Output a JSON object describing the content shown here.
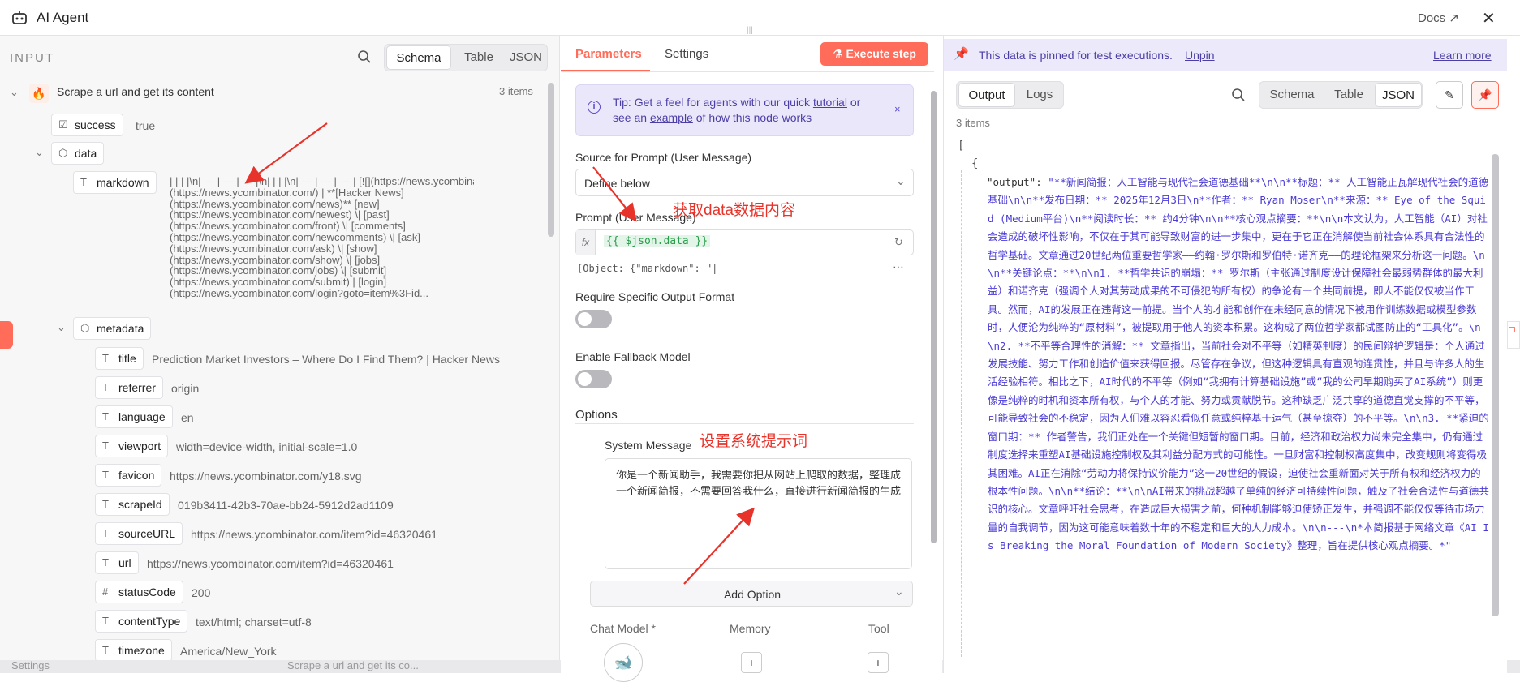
{
  "window": {
    "title": "AI Agent",
    "docs_label": "Docs",
    "close": "✕"
  },
  "input": {
    "heading": "INPUT",
    "view_tabs": [
      "Schema",
      "Table",
      "JSON"
    ],
    "active_view": "Schema",
    "node_name": "Scrape a url and get its content",
    "items_count": "3 items",
    "fields": {
      "success": {
        "key": "success",
        "value": "true"
      },
      "data": {
        "key": "data"
      },
      "markdown": {
        "key": "markdown",
        "value": "| | | |\\n| --- | --- | --- |\\n| | | |\\n| --- | --- | --- | [![](https://news.ycombinator.com/y18.svg)]\n(https://news.ycombinator.com/) | **[Hacker News]\n(https://news.ycombinator.com/news)** [new]\n(https://news.ycombinator.com/newest) \\| [past]\n(https://news.ycombinator.com/front) \\| [comments]\n(https://news.ycombinator.com/newcomments) \\| [ask]\n(https://news.ycombinator.com/ask) \\| [show]\n(https://news.ycombinator.com/show) \\| [jobs]\n(https://news.ycombinator.com/jobs) \\| [submit]\n(https://news.ycombinator.com/submit) | [login]\n(https://news.ycombinator.com/login?goto=item%3Fid..."
      },
      "metadata": {
        "key": "metadata"
      },
      "meta_rows": [
        {
          "key": "title",
          "value": "Prediction Market Investors – Where Do I Find Them? | Hacker News",
          "type": "T"
        },
        {
          "key": "referrer",
          "value": "origin",
          "type": "T"
        },
        {
          "key": "language",
          "value": "en",
          "type": "T"
        },
        {
          "key": "viewport",
          "value": "width=device-width, initial-scale=1.0",
          "type": "T"
        },
        {
          "key": "favicon",
          "value": "https://news.ycombinator.com/y18.svg",
          "type": "T"
        },
        {
          "key": "scrapeId",
          "value": "019b3411-42b3-70ae-bb24-5912d2ad1109",
          "type": "T"
        },
        {
          "key": "sourceURL",
          "value": "https://news.ycombinator.com/item?id=46320461",
          "type": "T"
        },
        {
          "key": "url",
          "value": "https://news.ycombinator.com/item?id=46320461",
          "type": "T"
        },
        {
          "key": "statusCode",
          "value": "200",
          "type": "#"
        },
        {
          "key": "contentType",
          "value": "text/html; charset=utf-8",
          "type": "T"
        },
        {
          "key": "timezone",
          "value": "America/New_York",
          "type": "T"
        }
      ]
    },
    "bottom_hint": "Settings",
    "bottom_hint2": "Scrape a url and get its co..."
  },
  "parameters": {
    "tabs": [
      "Parameters",
      "Settings"
    ],
    "execute_label": "Execute step",
    "tip_text_1": "Tip: Get a feel for agents with our quick ",
    "tip_link_1": "tutorial",
    "tip_text_2": " or",
    "tip_text_3": "see an ",
    "tip_link_2": "example",
    "tip_text_4": " of how this node works",
    "source_label": "Source for Prompt (User Message)",
    "source_value": "Define below",
    "prompt_label": "Prompt (User Message)",
    "prompt_value": "{{ $json.data }}",
    "prompt_preview": "[Object: {\"markdown\": \"|",
    "require_format_label": "Require Specific Output Format",
    "fallback_label": "Enable Fallback Model",
    "options_label": "Options",
    "system_message_label": "System Message",
    "system_message_value": "你是一个新闻助手，我需要你把从网站上爬取的数据，整理成一个新闻简报，不需要回答我什么，直接进行新闻简报的生成",
    "add_option_label": "Add Option",
    "sub_nodes": [
      "Chat Model *",
      "Memory",
      "Tool"
    ]
  },
  "annotations": {
    "get_data": "获取data数据内容",
    "set_prompt": "设置系统提示词"
  },
  "output": {
    "pinned_text": "This data is pinned for test executions.",
    "unpin_label": "Unpin",
    "learn_more_label": "Learn more",
    "tabs": [
      "Output",
      "Logs"
    ],
    "view_tabs": [
      "Schema",
      "Table",
      "JSON"
    ],
    "active_view": "JSON",
    "items_count": "3 items",
    "json_open": "[",
    "json_obj_open": "{",
    "json_key": "\"output\":",
    "json_value": "\"**新闻简报：人工智能与现代社会道德基础**\\n\\n**标题：** 人工智能正瓦解现代社会的道德基础\\n\\n**发布日期：** 2025年12月3日\\n**作者：** Ryan Moser\\n**来源：** Eye of the Squid (Medium平台)\\n**阅读时长：** 约4分钟\\n\\n**核心观点摘要：**\\n\\n本文认为，人工智能（AI）对社会造成的破坏性影响，不仅在于其可能导致财富的进一步集中，更在于它正在消解使当前社会体系具有合法性的哲学基础。文章通过20世纪两位重要哲学家——约翰·罗尔斯和罗伯特·诺齐克——的理论框架来分析这一问题。\\n\\n**关键论点：**\\n\\n1.  **哲学共识的崩塌：** 罗尔斯（主张通过制度设计保障社会最弱势群体的最大利益）和诺齐克（强调个人对其劳动成果的不可侵犯的所有权）的争论有一个共同前提，即人不能仅仅被当作工具。然而，AI的发展正在违背这一前提。当个人的才能和创作在未经同意的情况下被用作训练数据或模型参数时，人便沦为纯粹的“原材料”，被提取用于他人的资本积累。这构成了两位哲学家都试图防止的“工具化”。\\n\\n2.  **不平等合理性的消解：** 文章指出，当前社会对不平等（如精英制度）的民间辩护逻辑是：个人通过发展技能、努力工作和创造价值来获得回报。尽管存在争议，但这种逻辑具有直观的连贯性，并且与许多人的生活经验相符。相比之下，AI时代的不平等（例如“我拥有计算基础设施”或“我的公司早期购买了AI系统”）则更像是纯粹的时机和资本所有权，与个人的才能、努力或贡献脱节。这种缺乏广泛共享的道德直觉支撑的不平等，可能导致社会的不稳定，因为人们难以容忍看似任意或纯粹基于运气（甚至掠夺）的不平等。\\n\\n3.  **紧迫的窗口期：** 作者警告，我们正处在一个关键但短暂的窗口期。目前，经济和政治权力尚未完全集中，仍有通过制度选择来重塑AI基础设施控制权及其利益分配方式的可能性。一旦财富和控制权高度集中，改变规则将变得极其困难。AI正在消除“劳动力将保持议价能力”这一20世纪的假设，迫使社会重新面对关于所有权和经济权力的根本性问题。\\n\\n**结论：**\\n\\nAI带来的挑战超越了单纯的经济可持续性问题，触及了社会合法性与道德共识的核心。文章呼吁社会思考，在造成巨大损害之前，何种机制能够迫使矫正发生，并强调不能仅仅等待市场力量的自我调节，因为这可能意味着数十年的不稳定和巨大的人力成本。\\n\\n---\\n*本简报基于网络文章《AI Is Breaking the Moral Foundation of Modern Society》整理，旨在提供核心观点摘要。*\""
  },
  "colors": {
    "accent": "#ff6d5a",
    "link": "#4a3bd6",
    "annotation": "#e8332a",
    "banner": "#ece9fb"
  }
}
